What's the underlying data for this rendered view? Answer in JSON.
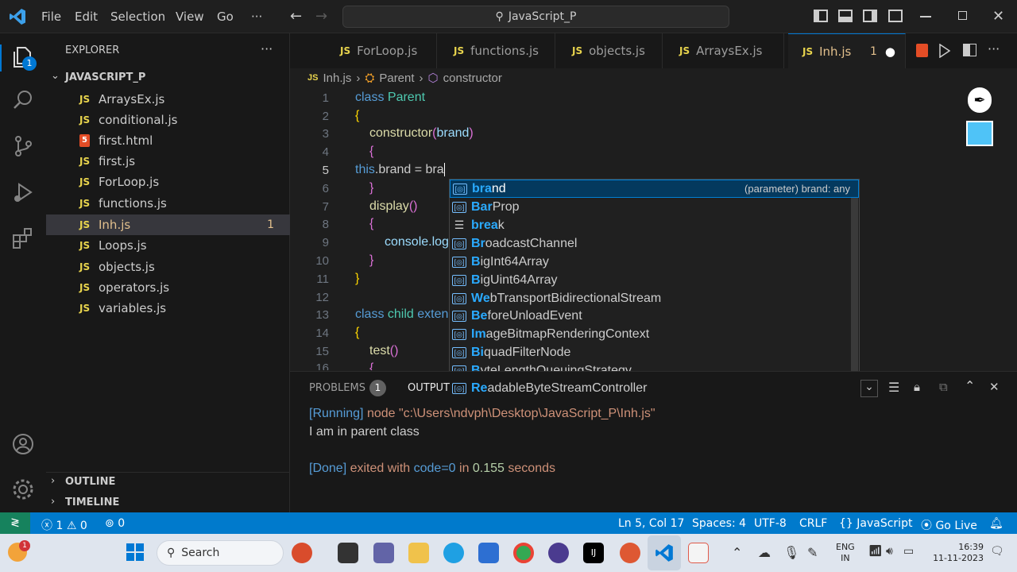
{
  "menu": [
    "File",
    "Edit",
    "Selection",
    "View",
    "Go",
    "···"
  ],
  "search": {
    "text": "JavaScript_P"
  },
  "explorer": {
    "header": "EXPLORER",
    "folder": "JAVASCRIPT_P",
    "files": [
      {
        "name": "ArraysEx.js",
        "tag": "JS"
      },
      {
        "name": "conditional.js",
        "tag": "JS"
      },
      {
        "name": "first.html",
        "tag": "5"
      },
      {
        "name": "first.js",
        "tag": "JS"
      },
      {
        "name": "ForLoop.js",
        "tag": "JS"
      },
      {
        "name": "functions.js",
        "tag": "JS"
      },
      {
        "name": "Inh.js",
        "tag": "JS",
        "badge": "1"
      },
      {
        "name": "Loops.js",
        "tag": "JS"
      },
      {
        "name": "objects.js",
        "tag": "JS"
      },
      {
        "name": "operators.js",
        "tag": "JS"
      },
      {
        "name": "variables.js",
        "tag": "JS"
      }
    ],
    "outline": "OUTLINE",
    "timeline": "TIMELINE",
    "activity_badge": "1"
  },
  "tabs": [
    {
      "label": "ForLoop.js",
      "tag": "JS"
    },
    {
      "label": "functions.js",
      "tag": "JS"
    },
    {
      "label": "objects.js",
      "tag": "JS"
    },
    {
      "label": "ArraysEx.js",
      "tag": "JS"
    },
    {
      "label": "Inh.js",
      "tag": "JS",
      "badge": "1",
      "dot": "●"
    }
  ],
  "breadcrumb": {
    "file": "Inh.js",
    "cls": "Parent",
    "member": "constructor",
    "tag": "JS"
  },
  "lines": [
    "1",
    "2",
    "3",
    "4",
    "5",
    "6",
    "7",
    "8",
    "9",
    "10",
    "11",
    "12",
    "13",
    "14",
    "15",
    "16"
  ],
  "code": {
    "l1a": "class",
    "l1b": " Parent",
    "l2": "{",
    "l3a": "constructor",
    "l3b": "(",
    "l3c": "brand",
    "l3d": ")",
    "l4": "{",
    "l5a": "this",
    "l5b": ".brand = bra",
    "l6": "}",
    "l7a": "display",
    "l7b": "()",
    "l8": "{",
    "l9": "console.log",
    "l10": "}",
    "l11": "}",
    "l13a": "class",
    "l13b": " child ",
    "l13c": "exten",
    "l14": "{",
    "l15a": "test",
    "l15b": "()",
    "l16": "{"
  },
  "suggestions": [
    {
      "pre": "bra",
      "rest": "nd",
      "detail": "(parameter) brand: any"
    },
    {
      "pre": "Bar",
      "rest": "Prop",
      "detail": ""
    },
    {
      "pre": "brea",
      "rest": "k",
      "detail": ""
    },
    {
      "pre": "Br",
      "rest": "oadcastChannel",
      "detail": ""
    },
    {
      "pre": "B",
      "rest": "igInt64Array",
      "detail": ""
    },
    {
      "pre": "B",
      "rest": "igUint64Array",
      "detail": ""
    },
    {
      "pre": "We",
      "rest": "bTransportBidirectionalStream",
      "detail": ""
    },
    {
      "pre": "Be",
      "rest": "foreUnloadEvent",
      "detail": ""
    },
    {
      "pre": "Im",
      "rest": "ageBitmapRenderingContext",
      "detail": ""
    },
    {
      "pre": "Bi",
      "rest": "quadFilterNode",
      "detail": ""
    },
    {
      "pre": "B",
      "rest": "yteLengthQueuingStrategy",
      "detail": ""
    },
    {
      "pre": "Re",
      "rest": "adableByteStreamController",
      "detail": ""
    }
  ],
  "panel": {
    "problems": "PROBLEMS",
    "problems_count": "1",
    "output": "OUTPUT",
    "run_tag": "[Running]",
    "run_cmd": " node \"c:\\Users\\ndvph\\Desktop\\JavaScript_P\\Inh.js\"",
    "line2": "I am in parent class",
    "done_tag": "[Done]",
    "done_a": " exited with ",
    "done_b": "code=0",
    " done_c": " in ",
    "done_d": "0.155",
    " done_e": " seconds",
    "done_in": " in ",
    "done_time": "0.155",
    "done_sec": " seconds"
  },
  "status": {
    "errors": "1",
    "warnings": "0",
    "ports": "0",
    "position": "Ln 5, Col 17",
    "spaces": "Spaces: 4",
    "encoding": "UTF-8",
    "eol": "CRLF",
    "lang": "JavaScript",
    "golive": "Go Live"
  },
  "taskbar": {
    "search": "Search",
    "lang1": "ENG",
    "lang2": "IN",
    "time": "16:39",
    "date": "11-11-2023",
    "notif": "1"
  }
}
